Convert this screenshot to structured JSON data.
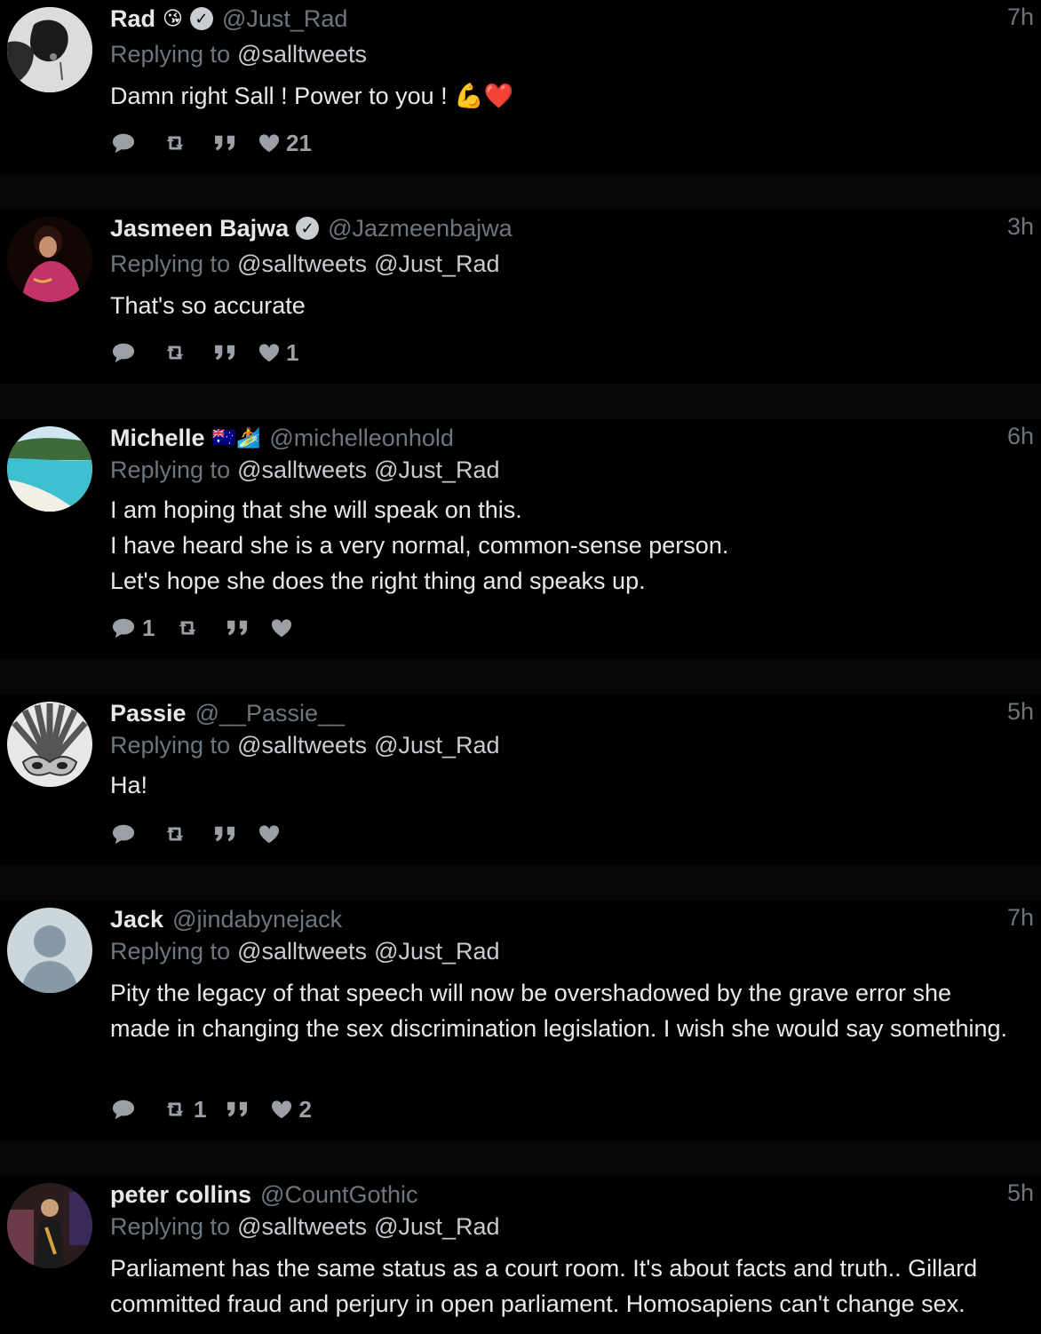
{
  "tweets": [
    {
      "name": "Rad",
      "emoji": "😘",
      "verified": true,
      "handle": "@Just_Rad",
      "time": "7h",
      "replying_label": "Replying to",
      "mentions": [
        "@salltweets"
      ],
      "text": "Damn right Sall ! Power to you ! 💪❤️",
      "counts": {
        "reply": "",
        "retweet": "",
        "like": "21"
      }
    },
    {
      "name": "Jasmeen Bajwa",
      "emoji": "",
      "verified": true,
      "handle": "@Jazmeenbajwa",
      "time": "3h",
      "replying_label": "Replying to",
      "mentions": [
        "@salltweets",
        "@Just_Rad"
      ],
      "text": "That's so accurate",
      "counts": {
        "reply": "",
        "retweet": "",
        "like": "1"
      }
    },
    {
      "name": "Michelle",
      "emoji": "🇦🇺🏄",
      "verified": false,
      "handle": "@michelleonhold",
      "time": "6h",
      "replying_label": "Replying to",
      "mentions": [
        "@salltweets",
        "@Just_Rad"
      ],
      "text": "I am hoping that she will speak on this.\nI have heard she is a very normal, common-sense person.\nLet's hope she does the right thing and speaks up.",
      "counts": {
        "reply": "1",
        "retweet": "",
        "like": ""
      }
    },
    {
      "name": "Passie",
      "emoji": "",
      "verified": false,
      "handle": "@__Passie__",
      "time": "5h",
      "replying_label": "Replying to",
      "mentions": [
        "@salltweets",
        "@Just_Rad"
      ],
      "text": "Ha!",
      "counts": {
        "reply": "",
        "retweet": "",
        "like": ""
      }
    },
    {
      "name": "Jack",
      "emoji": "",
      "verified": false,
      "handle": "@jindabynejack",
      "time": "7h",
      "replying_label": "Replying to",
      "mentions": [
        "@salltweets",
        "@Just_Rad"
      ],
      "text": "Pity the legacy of that speech will now be overshadowed by the grave error she made in changing the sex discrimination legislation. I wish she would say something.",
      "counts": {
        "reply": "",
        "retweet": "1",
        "like": "2"
      }
    },
    {
      "name": "peter collins",
      "emoji": "",
      "verified": false,
      "handle": "@CountGothic",
      "time": "5h",
      "replying_label": "Replying to",
      "mentions": [
        "@salltweets",
        "@Just_Rad"
      ],
      "text": "Parliament has the same status as a court room. It's about facts and truth.. Gillard committed fraud and perjury in open parliament.  Homosapiens can't change sex.",
      "counts": {
        "reply": "",
        "retweet": "",
        "like": ""
      }
    }
  ],
  "icons": {
    "reply": "reply-icon",
    "retweet": "retweet-icon",
    "quote": "quote-icon",
    "like": "heart-icon",
    "verified": "verified-badge-icon"
  }
}
